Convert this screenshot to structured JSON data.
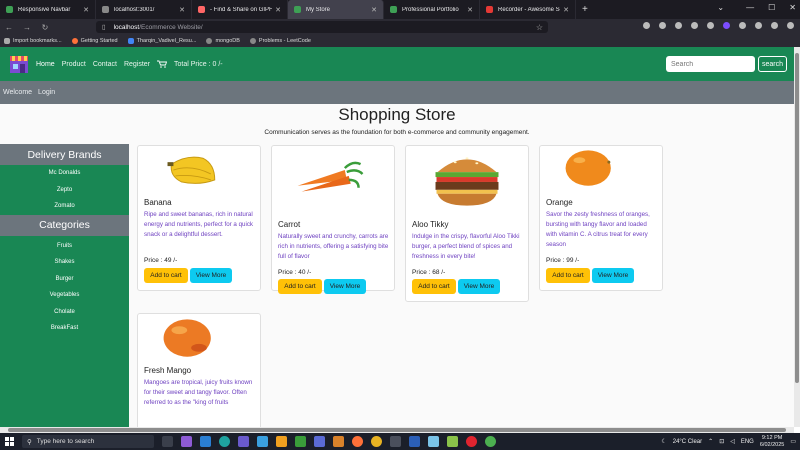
{
  "browser": {
    "tabs": [
      {
        "label": "Responsive Navbar",
        "color": "#3ea055"
      },
      {
        "label": "localhost:3001/",
        "color": "#888888"
      },
      {
        "label": "- Find & Share on GIPHY",
        "color": "#ff6666"
      },
      {
        "label": "My Store",
        "color": "#3ea055"
      },
      {
        "label": "Professional Portfolio",
        "color": "#3ea055"
      },
      {
        "label": "Recorder - Awesome Screensh",
        "color": "#e53935"
      }
    ],
    "active_tab_index": 3,
    "url_host": "localhost",
    "url_path": "/Ecommerce Website/",
    "bookmarks": [
      {
        "label": "Import bookmarks...",
        "color": "#aaaaaa"
      },
      {
        "label": "Getting Started",
        "color": "#ff7139"
      },
      {
        "label": "Tharqin_Vadivel_Resu...",
        "color": "#4285f4"
      },
      {
        "label": "mongoDB",
        "color": "#4db33d"
      },
      {
        "label": "Problems - LeetCode",
        "color": "#888888"
      }
    ]
  },
  "site": {
    "nav": {
      "links": [
        "Home",
        "Product",
        "Contact",
        "Register"
      ],
      "total_price": "Total Price : 0 /-",
      "search_placeholder": "Search",
      "search_button": "search"
    },
    "subnav": {
      "welcome": "Welcome",
      "login": "Login"
    },
    "title": "Shopping Store",
    "tagline": "Communication serves as the foundation for both e-commerce and community engagement.",
    "sidebar": {
      "brands_heading": "Delivery Brands",
      "brands": [
        "Mc Donalds",
        "Zepto",
        "Zomato"
      ],
      "categories_heading": "Categories",
      "categories": [
        "Fruits",
        "Shakes",
        "Burger",
        "Vegetables",
        "Cholate",
        "BreakFast"
      ]
    },
    "products": [
      {
        "name": "Banana",
        "description": "Ripe and sweet bananas, rich in natural energy and nutrients, perfect for a quick snack or a delightful dessert.",
        "price": "Price : 49 /-",
        "image": "banana"
      },
      {
        "name": "Carrot",
        "description": "Naturally sweet and crunchy, carrots are rich in nutrients, offering a satisfying bite full of flavor",
        "price": "Price : 40 /-",
        "image": "carrot"
      },
      {
        "name": "Aloo Tikky",
        "description": "Indulge in the crispy, flavorful Aloo Tikki burger, a perfect blend of spices and freshness in every bite!",
        "price": "Price : 68 /-",
        "image": "burger"
      },
      {
        "name": "Orange",
        "description": "Savor the zesty freshness of oranges, bursting with tangy flavor and loaded with vitamin C. A citrus treat for every season",
        "price": "Price : 99 /-",
        "image": "orange"
      },
      {
        "name": "Fresh Mango",
        "description": "Mangoes are tropical, juicy fruits known for their sweet and tangy flavor. Often referred to as the \"king of fruits",
        "price": "",
        "image": "mango"
      }
    ],
    "add_to_cart": "Add to cart",
    "view_more": "View More"
  },
  "taskbar": {
    "search_placeholder": "Type here to search",
    "weather": "24°C  Clear",
    "language": "ENG",
    "time": "9:12 PM",
    "date": "6/02/2025"
  },
  "colors": {
    "nav": "#198754",
    "subnav": "#6c757d",
    "cart_button": "#ffc107",
    "more_button": "#0dcaf0",
    "description": "#6f42c1"
  }
}
